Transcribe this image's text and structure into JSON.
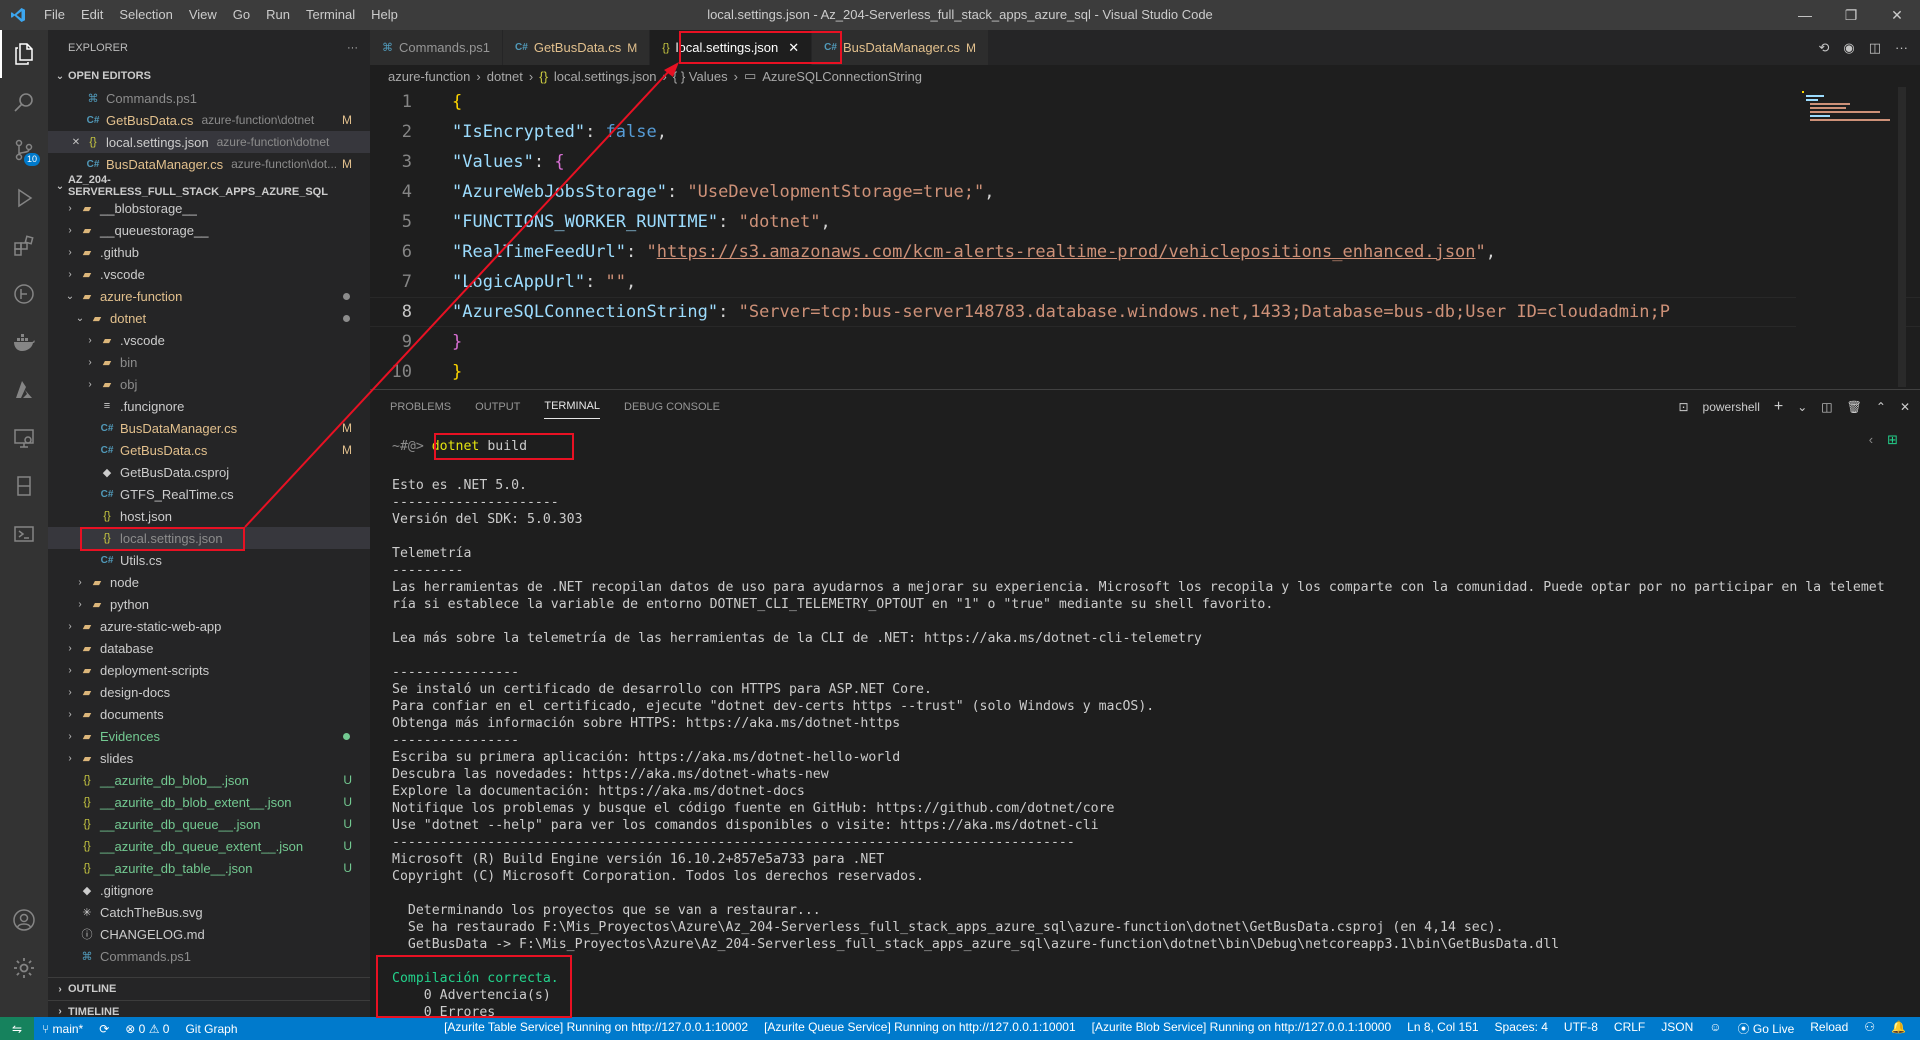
{
  "titlebar": {
    "menu": [
      "File",
      "Edit",
      "Selection",
      "View",
      "Go",
      "Run",
      "Terminal",
      "Help"
    ],
    "title": "local.settings.json - Az_204-Serverless_full_stack_apps_azure_sql - Visual Studio Code"
  },
  "activity": {
    "scm_badge": "10"
  },
  "sidebar": {
    "title": "EXPLORER",
    "more": "···",
    "open_editors_label": "OPEN EDITORS",
    "open_editors": [
      {
        "icon": "ps1-file-icon",
        "glyph": "⌘",
        "name": "Commands.ps1",
        "desc": "",
        "status": "",
        "cls": "t-grey"
      },
      {
        "icon": "csharp-file-icon",
        "glyph": "C#",
        "name": "GetBusData.cs",
        "desc": "azure-function\\dotnet",
        "status": "M",
        "cls": "t-mod"
      },
      {
        "icon": "json-file-icon",
        "glyph": "{}",
        "name": "local.settings.json",
        "desc": "azure-function\\dotnet",
        "status": "",
        "cls": "",
        "close": "✕",
        "selected": true
      },
      {
        "icon": "csharp-file-icon",
        "glyph": "C#",
        "name": "BusDataManager.cs",
        "desc": "azure-function\\dot...",
        "status": "M",
        "cls": "t-mod"
      }
    ],
    "workspace_label": "AZ_204-SERVERLESS_FULL_STACK_APPS_AZURE_SQL",
    "tree": [
      {
        "depth": 1,
        "chev": "›",
        "glyph": "▰",
        "name": "__blobstorage__",
        "cls": "",
        "status": "",
        "dot": ""
      },
      {
        "depth": 1,
        "chev": "›",
        "glyph": "▰",
        "name": "__queuestorage__",
        "cls": "",
        "status": "",
        "dot": ""
      },
      {
        "depth": 1,
        "chev": "›",
        "glyph": "▰",
        "name": ".github",
        "cls": "",
        "status": "",
        "dot": ""
      },
      {
        "depth": 1,
        "chev": "›",
        "glyph": "▰",
        "name": ".vscode",
        "cls": "",
        "status": "",
        "dot": ""
      },
      {
        "depth": 1,
        "chev": "⌄",
        "glyph": "▰",
        "name": "azure-function",
        "cls": "t-mod",
        "status": "",
        "dot": "grey"
      },
      {
        "depth": 2,
        "chev": "⌄",
        "glyph": "▰",
        "name": "dotnet",
        "cls": "t-mod",
        "status": "",
        "dot": "grey"
      },
      {
        "depth": 3,
        "chev": "›",
        "glyph": "▰",
        "name": ".vscode",
        "cls": "",
        "status": "",
        "dot": ""
      },
      {
        "depth": 3,
        "chev": "›",
        "glyph": "▰",
        "name": "bin",
        "cls": "t-grey",
        "status": "",
        "dot": ""
      },
      {
        "depth": 3,
        "chev": "›",
        "glyph": "▰",
        "name": "obj",
        "cls": "t-grey",
        "status": "",
        "dot": ""
      },
      {
        "depth": 3,
        "chev": "",
        "glyph": "≡",
        "name": ".funcignore",
        "cls": "",
        "status": "",
        "dot": ""
      },
      {
        "depth": 3,
        "chev": "",
        "glyph": "C#",
        "name": "BusDataManager.cs",
        "cls": "t-mod",
        "status": "M",
        "dot": ""
      },
      {
        "depth": 3,
        "chev": "",
        "glyph": "C#",
        "name": "GetBusData.cs",
        "cls": "t-mod",
        "status": "M",
        "dot": ""
      },
      {
        "depth": 3,
        "chev": "",
        "glyph": "◆",
        "name": "GetBusData.csproj",
        "cls": "",
        "status": "",
        "dot": ""
      },
      {
        "depth": 3,
        "chev": "",
        "glyph": "C#",
        "name": "GTFS_RealTime.cs",
        "cls": "",
        "status": "",
        "dot": ""
      },
      {
        "depth": 3,
        "chev": "",
        "glyph": "{}",
        "name": "host.json",
        "cls": "",
        "status": "",
        "dot": ""
      },
      {
        "depth": 3,
        "chev": "",
        "glyph": "{}",
        "name": "local.settings.json",
        "cls": "t-grey",
        "status": "",
        "dot": "",
        "selected": true
      },
      {
        "depth": 3,
        "chev": "",
        "glyph": "C#",
        "name": "Utils.cs",
        "cls": "",
        "status": "",
        "dot": ""
      },
      {
        "depth": 2,
        "chev": "›",
        "glyph": "▰",
        "name": "node",
        "cls": "",
        "status": "",
        "dot": ""
      },
      {
        "depth": 2,
        "chev": "›",
        "glyph": "▰",
        "name": "python",
        "cls": "",
        "status": "",
        "dot": ""
      },
      {
        "depth": 1,
        "chev": "›",
        "glyph": "▰",
        "name": "azure-static-web-app",
        "cls": "",
        "status": "",
        "dot": ""
      },
      {
        "depth": 1,
        "chev": "›",
        "glyph": "▰",
        "name": "database",
        "cls": "",
        "status": "",
        "dot": ""
      },
      {
        "depth": 1,
        "chev": "›",
        "glyph": "▰",
        "name": "deployment-scripts",
        "cls": "",
        "status": "",
        "dot": ""
      },
      {
        "depth": 1,
        "chev": "›",
        "glyph": "▰",
        "name": "design-docs",
        "cls": "",
        "status": "",
        "dot": ""
      },
      {
        "depth": 1,
        "chev": "›",
        "glyph": "▰",
        "name": "documents",
        "cls": "",
        "status": "",
        "dot": ""
      },
      {
        "depth": 1,
        "chev": "›",
        "glyph": "▰",
        "name": "Evidences",
        "cls": "t-unt",
        "status": "",
        "dot": "green"
      },
      {
        "depth": 1,
        "chev": "›",
        "glyph": "▰",
        "name": "slides",
        "cls": "",
        "status": "",
        "dot": ""
      },
      {
        "depth": 1,
        "chev": "",
        "glyph": "{}",
        "name": "__azurite_db_blob__.json",
        "cls": "t-unt",
        "status": "U",
        "dot": ""
      },
      {
        "depth": 1,
        "chev": "",
        "glyph": "{}",
        "name": "__azurite_db_blob_extent__.json",
        "cls": "t-unt",
        "status": "U",
        "dot": ""
      },
      {
        "depth": 1,
        "chev": "",
        "glyph": "{}",
        "name": "__azurite_db_queue__.json",
        "cls": "t-unt",
        "status": "U",
        "dot": ""
      },
      {
        "depth": 1,
        "chev": "",
        "glyph": "{}",
        "name": "__azurite_db_queue_extent__.json",
        "cls": "t-unt",
        "status": "U",
        "dot": ""
      },
      {
        "depth": 1,
        "chev": "",
        "glyph": "{}",
        "name": "__azurite_db_table__.json",
        "cls": "t-unt",
        "status": "U",
        "dot": ""
      },
      {
        "depth": 1,
        "chev": "",
        "glyph": "◆",
        "name": ".gitignore",
        "cls": "",
        "status": "",
        "dot": ""
      },
      {
        "depth": 1,
        "chev": "",
        "glyph": "✳",
        "name": "CatchTheBus.svg",
        "cls": "",
        "status": "",
        "dot": ""
      },
      {
        "depth": 1,
        "chev": "",
        "glyph": "ⓘ",
        "name": "CHANGELOG.md",
        "cls": "",
        "status": "",
        "dot": ""
      },
      {
        "depth": 1,
        "chev": "",
        "glyph": "⌘",
        "name": "Commands.ps1",
        "cls": "t-grey",
        "status": "",
        "dot": ""
      }
    ],
    "outline_label": "OUTLINE",
    "timeline_label": "TIMELINE"
  },
  "tabs": [
    {
      "glyph": "⌘",
      "label": "Commands.ps1",
      "mark": "",
      "active": false
    },
    {
      "glyph": "C#",
      "label": "GetBusData.cs",
      "mark": "M",
      "active": false
    },
    {
      "glyph": "{}",
      "label": "local.settings.json",
      "mark": "",
      "active": true,
      "close": "✕"
    },
    {
      "glyph": "C#",
      "label": "BusDataManager.cs",
      "mark": "M",
      "active": false
    }
  ],
  "breadcrumbs": [
    "azure-function",
    "dotnet",
    "local.settings.json",
    "{ } Values",
    "AzureSQLConnectionString"
  ],
  "editor": {
    "lines": [
      {
        "n": "1",
        "tokens": [
          [
            "br",
            "{"
          ]
        ]
      },
      {
        "n": "2",
        "tokens": [
          [
            "p",
            "    "
          ],
          [
            "k",
            "\"IsEncrypted\""
          ],
          [
            "p",
            ": "
          ],
          [
            "b",
            "false"
          ],
          [
            "p",
            ","
          ]
        ]
      },
      {
        "n": "3",
        "tokens": [
          [
            "p",
            "    "
          ],
          [
            "k",
            "\"Values\""
          ],
          [
            "p",
            ": "
          ],
          [
            "br2",
            "{"
          ]
        ]
      },
      {
        "n": "4",
        "tokens": [
          [
            "p",
            "        "
          ],
          [
            "k",
            "\"AzureWebJobsStorage\""
          ],
          [
            "p",
            ": "
          ],
          [
            "s",
            "\"UseDevelopmentStorage=true;\""
          ],
          [
            "p",
            ","
          ]
        ]
      },
      {
        "n": "5",
        "tokens": [
          [
            "p",
            "        "
          ],
          [
            "k",
            "\"FUNCTIONS_WORKER_RUNTIME\""
          ],
          [
            "p",
            ": "
          ],
          [
            "s",
            "\"dotnet\""
          ],
          [
            "p",
            ","
          ]
        ]
      },
      {
        "n": "6",
        "tokens": [
          [
            "p",
            "        "
          ],
          [
            "k",
            "\"RealTimeFeedUrl\""
          ],
          [
            "p",
            ": "
          ],
          [
            "s",
            "\""
          ],
          [
            "su",
            "https://s3.amazonaws.com/kcm-alerts-realtime-prod/vehiclepositions_enhanced.json"
          ],
          [
            "s",
            "\""
          ],
          [
            "p",
            ","
          ]
        ]
      },
      {
        "n": "7",
        "tokens": [
          [
            "p",
            "        "
          ],
          [
            "k",
            "\"LogicAppUrl\""
          ],
          [
            "p",
            ": "
          ],
          [
            "s",
            "\"\""
          ],
          [
            "p",
            ","
          ]
        ]
      },
      {
        "n": "8",
        "tokens": [
          [
            "p",
            "        "
          ],
          [
            "k",
            "\"AzureSQLConnectionString\""
          ],
          [
            "p",
            ": "
          ],
          [
            "s",
            "\"Server=tcp:bus-server148783.database.windows.net,1433;Database=bus-db;User ID=cloudadmin;P"
          ]
        ]
      },
      {
        "n": "9",
        "tokens": [
          [
            "p",
            "    "
          ],
          [
            "br2",
            "}"
          ]
        ]
      },
      {
        "n": "10",
        "tokens": [
          [
            "br",
            "}"
          ]
        ]
      }
    ],
    "current_line": "8"
  },
  "panel": {
    "tabs": [
      "PROBLEMS",
      "OUTPUT",
      "TERMINAL",
      "DEBUG CONSOLE"
    ],
    "active_tab": "TERMINAL",
    "shell": "powershell",
    "plus": "+",
    "prompt": "~#@>",
    "command_bin": "dotnet",
    "command_arg": "build",
    "lines": [
      "",
      "Esto es .NET 5.0.",
      "---------------------",
      "Versión del SDK: 5.0.303",
      "",
      "Telemetría",
      "---------",
      "Las herramientas de .NET recopilan datos de uso para ayudarnos a mejorar su experiencia. Microsoft los recopila y los comparte con la comunidad. Puede optar por no participar en la telemet",
      "ría si establece la variable de entorno DOTNET_CLI_TELEMETRY_OPTOUT en \"1\" o \"true\" mediante su shell favorito.",
      "",
      "Lea más sobre la telemetría de las herramientas de la CLI de .NET: https://aka.ms/dotnet-cli-telemetry",
      "",
      "----------------",
      "Se instaló un certificado de desarrollo con HTTPS para ASP.NET Core.",
      "Para confiar en el certificado, ejecute \"dotnet dev-certs https --trust\" (solo Windows y macOS).",
      "Obtenga más información sobre HTTPS: https://aka.ms/dotnet-https",
      "----------------",
      "Escriba su primera aplicación: https://aka.ms/dotnet-hello-world",
      "Descubra las novedades: https://aka.ms/dotnet-whats-new",
      "Explore la documentación: https://aka.ms/dotnet-docs",
      "Notifique los problemas y busque el código fuente en GitHub: https://github.com/dotnet/core",
      "Use \"dotnet --help\" para ver los comandos disponibles o visite: https://aka.ms/dotnet-cli",
      "--------------------------------------------------------------------------------------",
      "Microsoft (R) Build Engine versión 16.10.2+857e5a733 para .NET",
      "Copyright (C) Microsoft Corporation. Todos los derechos reservados.",
      "",
      "  Determinando los proyectos que se van a restaurar...",
      "  Se ha restaurado F:\\Mis_Proyectos\\Azure\\Az_204-Serverless_full_stack_apps_azure_sql\\azure-function\\dotnet\\GetBusData.csproj (en 4,14 sec).",
      "  GetBusData -> F:\\Mis_Proyectos\\Azure\\Az_204-Serverless_full_stack_apps_azure_sql\\azure-function\\dotnet\\bin\\Debug\\netcoreapp3.1\\bin\\GetBusData.dll",
      ""
    ],
    "result_title": "Compilación correcta.",
    "result_warnings": "    0 Advertencia(s)",
    "result_errors": "    0 Errores"
  },
  "statusbar": {
    "branch": "main*",
    "errors": "⊗ 0 ⚠ 0",
    "gitgraph": "Git Graph",
    "azurite_table": "[Azurite Table Service] Running on http://127.0.0.1:10002",
    "azurite_queue": "[Azurite Queue Service] Running on http://127.0.0.1:10001",
    "azurite_blob": "[Azurite Blob Service] Running on http://127.0.0.1:10000",
    "position": "Ln 8, Col 151",
    "spaces": "Spaces: 4",
    "encoding": "UTF-8",
    "eol": "CRLF",
    "language": "JSON",
    "golive": "⦿ Go Live",
    "reload": "Reload"
  },
  "colors": {
    "accent": "#007acc",
    "annotation": "#e81123",
    "success": "#23d18b"
  }
}
